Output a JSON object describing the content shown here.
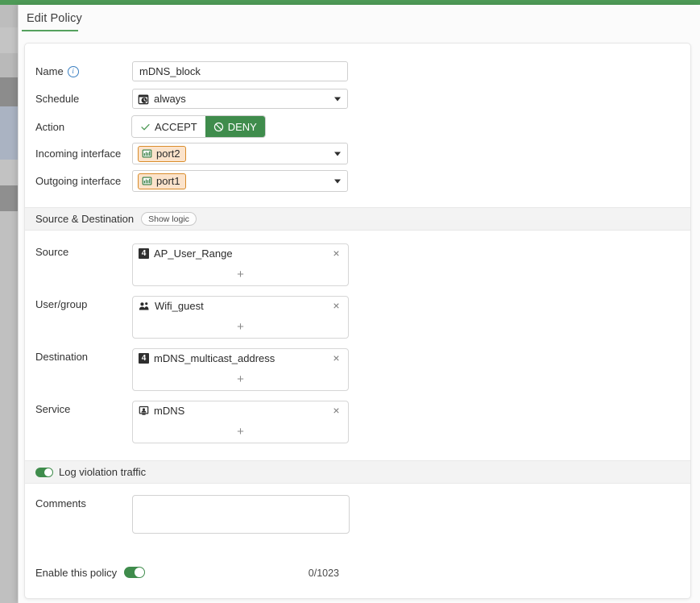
{
  "top_bar": {
    "color": "#4e9a57"
  },
  "tab": {
    "label": "Edit Policy",
    "underline_color": "#55a15e"
  },
  "form": {
    "name": {
      "label": "Name",
      "info_icon": "info-icon",
      "value": "mDNS_block",
      "placeholder": ""
    },
    "schedule": {
      "label": "Schedule",
      "value": "always",
      "icon": "schedule-clock-icon"
    },
    "action": {
      "label": "Action",
      "options": [
        {
          "label": "ACCEPT",
          "icon": "check-icon",
          "selected": false
        },
        {
          "label": "DENY",
          "icon": "deny-circle-slash-icon",
          "selected": true
        }
      ],
      "selected_color": "#3f8c4c"
    },
    "incoming_interface": {
      "label": "Incoming interface",
      "value": "port2",
      "icon": "ethernet-port-icon",
      "chip_border": "#d98c2b",
      "chip_background": "#fbe3cb"
    },
    "outgoing_interface": {
      "label": "Outgoing interface",
      "value": "port1",
      "icon": "ethernet-port-icon",
      "chip_border": "#d98c2b",
      "chip_background": "#fbe3cb"
    }
  },
  "source_destination": {
    "section_title": "Source & Destination",
    "show_logic_label": "Show logic",
    "rows": [
      {
        "label": "Source",
        "items": [
          {
            "name": "AP_User_Range",
            "icon": "ipv4-address-icon"
          }
        ],
        "add_label": "+",
        "remove_label": "×"
      },
      {
        "label": "User/group",
        "items": [
          {
            "name": "Wifi_guest",
            "icon": "user-group-icon"
          }
        ],
        "add_label": "+",
        "remove_label": "×"
      },
      {
        "label": "Destination",
        "items": [
          {
            "name": "mDNS_multicast_address",
            "icon": "ipv4-address-icon"
          }
        ],
        "add_label": "+",
        "remove_label": "×"
      },
      {
        "label": "Service",
        "items": [
          {
            "name": "mDNS",
            "icon": "service-monitor-icon"
          }
        ],
        "add_label": "+",
        "remove_label": "×"
      }
    ]
  },
  "log_violation": {
    "label": "Log violation traffic",
    "enabled": true,
    "color": "#3f8c4c"
  },
  "comments": {
    "label": "Comments",
    "value": "",
    "placeholder": "",
    "counter": "0/1023"
  },
  "enable_policy": {
    "label": "Enable this policy",
    "enabled": true,
    "color": "#3f8c4c"
  }
}
